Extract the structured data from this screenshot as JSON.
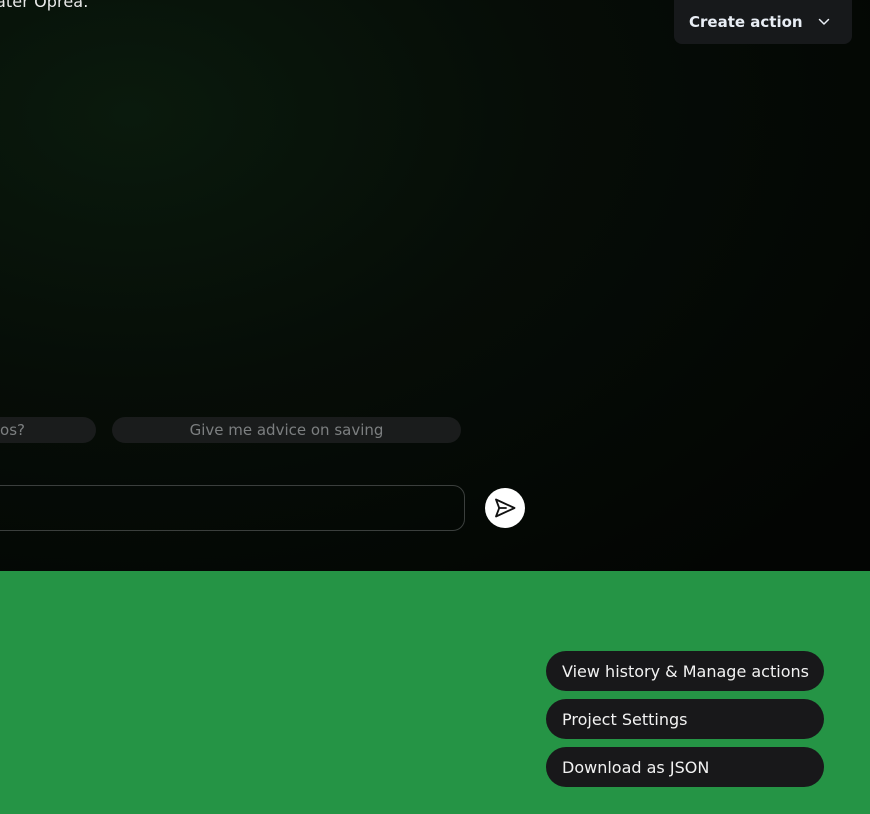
{
  "header": {
    "text_fragment": "ater Oprea."
  },
  "toolbar": {
    "create_action_label": "Create action"
  },
  "suggestions": [
    {
      "label": "os?"
    },
    {
      "label": "Give me advice on saving"
    }
  ],
  "chat": {
    "input_value": ""
  },
  "actions": {
    "view_history_label": "View history & Manage actions",
    "project_settings_label": "Project Settings",
    "download_json_label": "Download as JSON"
  },
  "colors": {
    "panel_bg": "#060d07",
    "footer_green": "#259445",
    "button_dark": "#18181a",
    "chip_bg": "#1a1c1c",
    "chip_text": "#7c7f80"
  },
  "icons": {
    "create_action_chevron": "chevron-down-icon",
    "send": "send-icon"
  }
}
